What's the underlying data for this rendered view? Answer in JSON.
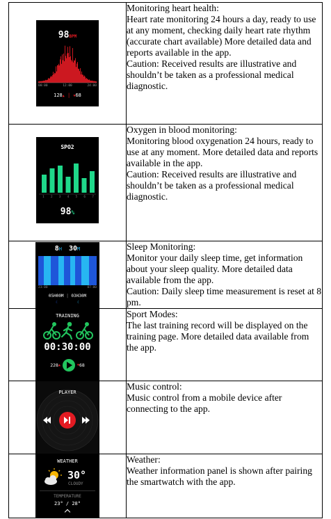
{
  "rows": [
    {
      "screen": {
        "type": "heart",
        "bpm_value": "98",
        "bpm_unit": "BPM",
        "time_labels": [
          "00:00",
          "12:00",
          "24:00"
        ],
        "max_value": "128",
        "min_value": "68",
        "accent": "#e31b23"
      },
      "title": "Monitoring heart health:",
      "desc": "Heart rate monitoring 24 hours a day, ready to use at any moment, checking daily heart rate rhythm (accurate chart available) More detailed data and reports available in the app.",
      "caution": "Caution: Received results are illustrative and shouldn’t be taken as a professional medical diagnostic."
    },
    {
      "screen": {
        "type": "spo2",
        "title": "SPO2",
        "day_labels": [
          "1",
          "2",
          "3",
          "4",
          "5",
          "6",
          "7"
        ],
        "bar_levels": [
          0.52,
          0.7,
          0.78,
          0.46,
          0.84,
          0.42,
          0.62
        ],
        "value": "98",
        "unit": "%",
        "accent": "#1fd88a"
      },
      "title": "Oxygen in blood monitoring:",
      "desc": "Monitoring blood oxygenation 24 hours, ready to use at any moment. More detailed data and reports available in the app.",
      "caution": "Caution: Received results are illustrative and shouldn’t be taken as a professional medical diagnostic."
    },
    {
      "screen": {
        "type": "sleep",
        "hours": "8",
        "hours_unit": "H",
        "minutes": "30",
        "minutes_unit": "M",
        "time_labels": [
          "23:00",
          "07:00"
        ],
        "deep_sleep": "05H00M",
        "light_sleep": "03H30M",
        "deep_color": "#1e56d9",
        "light_color": "#27b6f2"
      },
      "title": "Sleep Monitoring:",
      "desc": "Monitor your daily sleep time, get information about your sleep quality. More detailed data available from the app.",
      "caution": "Caution: Daily sleep time measurement is reset at 8 pm."
    },
    {
      "screen": {
        "type": "training",
        "title": "TRAINING",
        "time": "00:30:00",
        "max_value": "228",
        "min_value": "68",
        "accent": "#22c55e",
        "icons": [
          "cycling-icon",
          "running-icon",
          "cycling-icon"
        ]
      },
      "title": "Sport Modes:",
      "desc": "The last training record will be displayed on the training page. More detailed data available from the app.",
      "caution": ""
    },
    {
      "screen": {
        "type": "player",
        "title": "PLAYER",
        "accent": "#e31b23",
        "icons": [
          "previous-icon",
          "play-pause-icon",
          "next-icon"
        ]
      },
      "title": "Music control:",
      "desc": "Music control from a mobile device after connecting to the app.",
      "caution": ""
    },
    {
      "screen": {
        "type": "weather",
        "title": "WEATHER",
        "temp": "30°",
        "condition": "CLOUDY",
        "label": "TEMPERATURE",
        "low": "23°",
        "separator": "/",
        "high": "28°",
        "icon": "partly-cloudy-icon"
      },
      "title": "Weather:",
      "desc": "Weather information panel is shown after pairing the smartwatch with the app.",
      "caution": ""
    }
  ]
}
